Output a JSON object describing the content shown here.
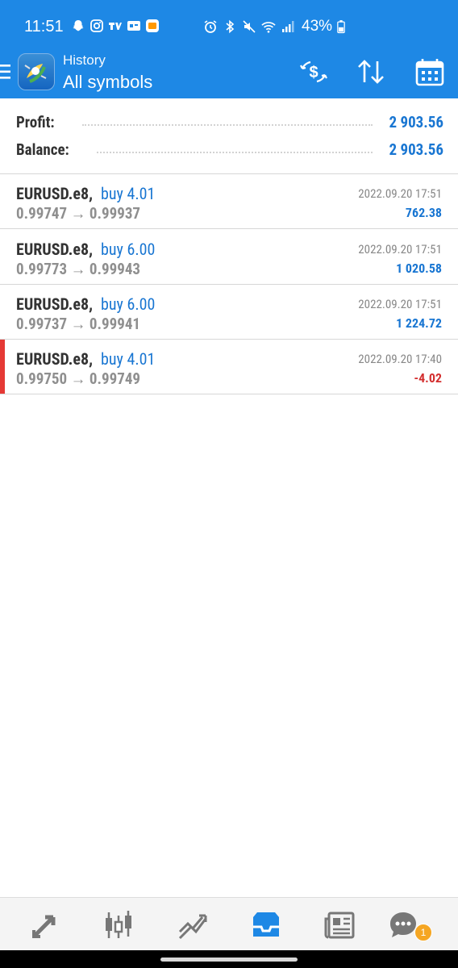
{
  "status_bar": {
    "time": "11:51",
    "battery": "43%"
  },
  "app_bar": {
    "subtitle": "History",
    "title": "All symbols"
  },
  "summary": {
    "profit_label": "Profit:",
    "profit_value": "2 903.56",
    "balance_label": "Balance:",
    "balance_value": "2 903.56"
  },
  "deals": [
    {
      "symbol": "EURUSD.e8,",
      "side": "buy 4.01",
      "prices": "0.99747 → 0.99937",
      "time": "2022.09.20 17:51",
      "profit": "762.38"
    },
    {
      "symbol": "EURUSD.e8,",
      "side": "buy 6.00",
      "prices": "0.99773 → 0.99943",
      "time": "2022.09.20 17:51",
      "profit": "1 020.58"
    },
    {
      "symbol": "EURUSD.e8,",
      "side": "buy 6.00",
      "prices": "0.99737 → 0.99941",
      "time": "2022.09.20 17:51",
      "profit": "1 224.72"
    },
    {
      "symbol": "EURUSD.e8,",
      "side": "buy 4.01",
      "prices": "0.99750 → 0.99749",
      "time": "2022.09.20 17:40",
      "profit": "-4.02"
    }
  ],
  "bottom_nav": {
    "chat_badge": "1"
  },
  "colors": {
    "primary": "#1e88e5",
    "profit_positive": "#1976d2",
    "profit_negative": "#d32f2f",
    "loss_marker": "#e53935",
    "badge": "#f5a623"
  }
}
